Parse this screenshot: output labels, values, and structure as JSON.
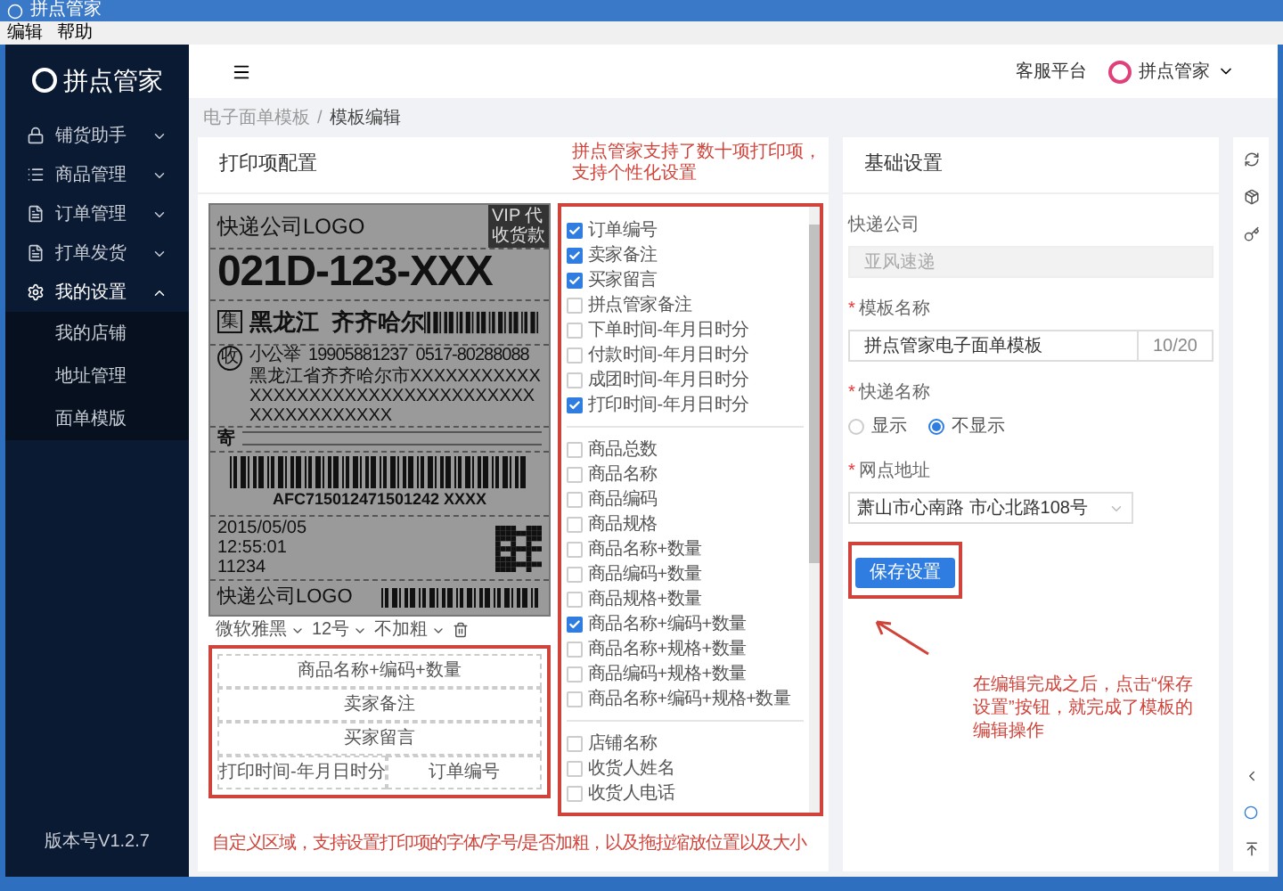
{
  "window": {
    "title": "拼点管家"
  },
  "menu_bar": [
    "编辑",
    "帮助"
  ],
  "sidebar": {
    "logo": "拼点管家",
    "items": [
      {
        "label": "铺货助手",
        "expanded": false
      },
      {
        "label": "商品管理",
        "expanded": false
      },
      {
        "label": "订单管理",
        "expanded": false
      },
      {
        "label": "打单发货",
        "expanded": false
      },
      {
        "label": "我的设置",
        "expanded": true,
        "children": [
          "我的店铺",
          "地址管理",
          "面单模版"
        ]
      }
    ],
    "version": "版本号V1.2.7"
  },
  "header": {
    "service": "客服平台",
    "user": "拼点管家"
  },
  "breadcrumb": {
    "items": [
      "电子面单模板",
      "模板编辑"
    ],
    "separator": "/"
  },
  "print_panel": {
    "title": "打印项配置",
    "waybill": {
      "logo": "快递公司LOGO",
      "vip": "VIP 代收货款",
      "code": "021D-123-XXX",
      "stamp": "集",
      "city": "黑龙江  齐齐哈尔",
      "receiver_mark": "收",
      "receiver": "小公举  19905881237  0517-80288088",
      "address": "黑龙江省齐齐哈尔市XXXXXXXXXXXXXXXXXXXXXXXXXXXXXXXXXXXXXXXXXXXXXXX",
      "sender_mark": "寄",
      "barcode_number": "AFC715012471501242 XXXX",
      "date": "2015/05/05",
      "time": "12:55:01",
      "number": "11234",
      "logo_2": "快递公司LOGO"
    },
    "toolbar": {
      "font": "微软雅黑",
      "size": "12号",
      "weight": "不加粗"
    },
    "custom_rows": [
      [
        "商品名称+编码+数量"
      ],
      [
        "卖家备注"
      ],
      [
        "买家留言"
      ],
      [
        "打印时间-年月日时分",
        "订单编号"
      ]
    ]
  },
  "annotations": {
    "top": "拼点管家支持了数十项打印项，支持个性化设置",
    "bottom": "自定义区域，支持设置打印项的字体/字号/是否加粗，以及拖拉缩放位置以及大小",
    "right": "在编辑完成之后，点击“保存设置”按钮，就完成了模板的编辑操作"
  },
  "print_items": [
    [
      {
        "label": "订单编号",
        "checked": true
      },
      {
        "label": "卖家备注",
        "checked": true
      },
      {
        "label": "买家留言",
        "checked": true
      },
      {
        "label": "拼点管家备注",
        "checked": false
      },
      {
        "label": "下单时间-年月日时分",
        "checked": false
      },
      {
        "label": "付款时间-年月日时分",
        "checked": false
      },
      {
        "label": "成团时间-年月日时分",
        "checked": false
      },
      {
        "label": "打印时间-年月日时分",
        "checked": true
      }
    ],
    [
      {
        "label": "商品总数",
        "checked": false
      },
      {
        "label": "商品名称",
        "checked": false
      },
      {
        "label": "商品编码",
        "checked": false
      },
      {
        "label": "商品规格",
        "checked": false
      },
      {
        "label": "商品名称+数量",
        "checked": false
      },
      {
        "label": "商品编码+数量",
        "checked": false
      },
      {
        "label": "商品规格+数量",
        "checked": false
      },
      {
        "label": "商品名称+编码+数量",
        "checked": true
      },
      {
        "label": "商品名称+规格+数量",
        "checked": false
      },
      {
        "label": "商品编码+规格+数量",
        "checked": false
      },
      {
        "label": "商品名称+编码+规格+数量",
        "checked": false
      }
    ],
    [
      {
        "label": "店铺名称",
        "checked": false
      },
      {
        "label": "收货人姓名",
        "checked": false
      },
      {
        "label": "收货人电话",
        "checked": false
      }
    ]
  ],
  "basic_settings": {
    "title": "基础设置",
    "required_mark": "*",
    "company": {
      "label": "快递公司",
      "placeholder": "亚风速递",
      "disabled": true
    },
    "template_name": {
      "label": "模板名称",
      "required": true,
      "value": "拼点管家电子面单模板",
      "count": "10/20"
    },
    "express_name": {
      "label": "快递名称",
      "required": true,
      "options": [
        {
          "label": "显示",
          "selected": false
        },
        {
          "label": "不显示",
          "selected": true
        }
      ]
    },
    "branch_address": {
      "label": "网点地址",
      "required": true,
      "value": "萧山市心南路 市心北路108号"
    },
    "save_button": "保存设置"
  }
}
